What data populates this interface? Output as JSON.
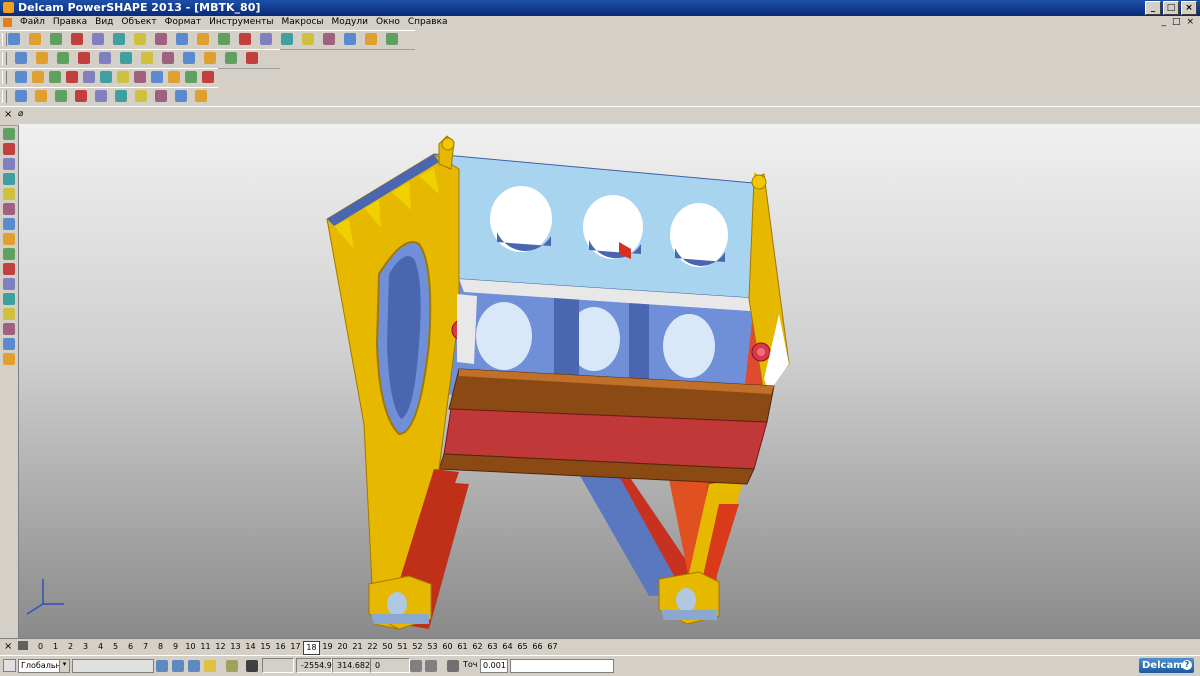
{
  "window": {
    "title": "Delcam PowerSHAPE 2013 - [MBTK_80]",
    "buttons": [
      "_",
      "□",
      "×"
    ]
  },
  "menu": {
    "items": [
      "Файл",
      "Правка",
      "Вид",
      "Объект",
      "Формат",
      "Инструменты",
      "Макросы",
      "Модули",
      "Окно",
      "Справка"
    ],
    "mdi_buttons": [
      "_",
      "□",
      "×"
    ]
  },
  "toolbars": {
    "row1_icons": [
      "new-icon",
      "open-icon",
      "save-icon",
      "print-icon",
      "cut-icon",
      "copy-icon",
      "paste-icon",
      "delete-icon",
      "undo-icon",
      "redo-icon",
      "select-icon",
      "line-icon",
      "arc-icon",
      "circle-icon",
      "curve-icon",
      "surface-icon",
      "solid-icon",
      "mesh-icon",
      "wireframe-icon"
    ],
    "row2_icons": [
      "view-top-icon",
      "view-front-icon",
      "view-iso-icon",
      "zoom-icon",
      "zoom-in-icon",
      "zoom-out-icon",
      "pan-icon",
      "rotate-icon",
      "shade-icon",
      "light-icon",
      "render-icon",
      "measure-icon"
    ],
    "row3_icons": [
      "solid-box-icon",
      "solid-cyl-icon",
      "solid-sphere-icon",
      "solid-cone-icon",
      "extrude-icon",
      "revolve-icon",
      "boolean-icon",
      "fillet-icon",
      "chamfer-icon",
      "shell-icon",
      "feature-icon",
      "pattern-icon"
    ],
    "row4_icons": [
      "layer-icon",
      "model-icon",
      "assembly-icon",
      "component-icon",
      "drawing-icon",
      "sheet-icon",
      "detail-icon",
      "section-icon",
      "dimension-icon",
      "annotation-icon"
    ]
  },
  "level_bar": {
    "levels": [
      "0",
      "1",
      "2",
      "3",
      "4",
      "5",
      "6",
      "7",
      "8",
      "9",
      "10",
      "11",
      "12",
      "13",
      "14",
      "15",
      "16",
      "17",
      "18",
      "19",
      "20",
      "21",
      "22",
      "50",
      "51",
      "52",
      "53",
      "60",
      "61",
      "62",
      "63",
      "64",
      "65",
      "66",
      "67"
    ],
    "selected": "18"
  },
  "status": {
    "workplane": "Глобальна",
    "x": "-2554.9",
    "y": "314.682",
    "z": "0",
    "tolerance_label": "Точ",
    "tolerance": "0.001",
    "logo": "Delcam"
  },
  "viewport": {
    "background": "#b8b8b8",
    "colors": {
      "frame_yellow": "#e6b800",
      "panel_blue": "#a8d4f0",
      "inner_blue": "#6f8fd8",
      "beam_brown": "#8b4a14",
      "beam_red": "#c03838",
      "leg_red": "#d83a1a"
    }
  }
}
